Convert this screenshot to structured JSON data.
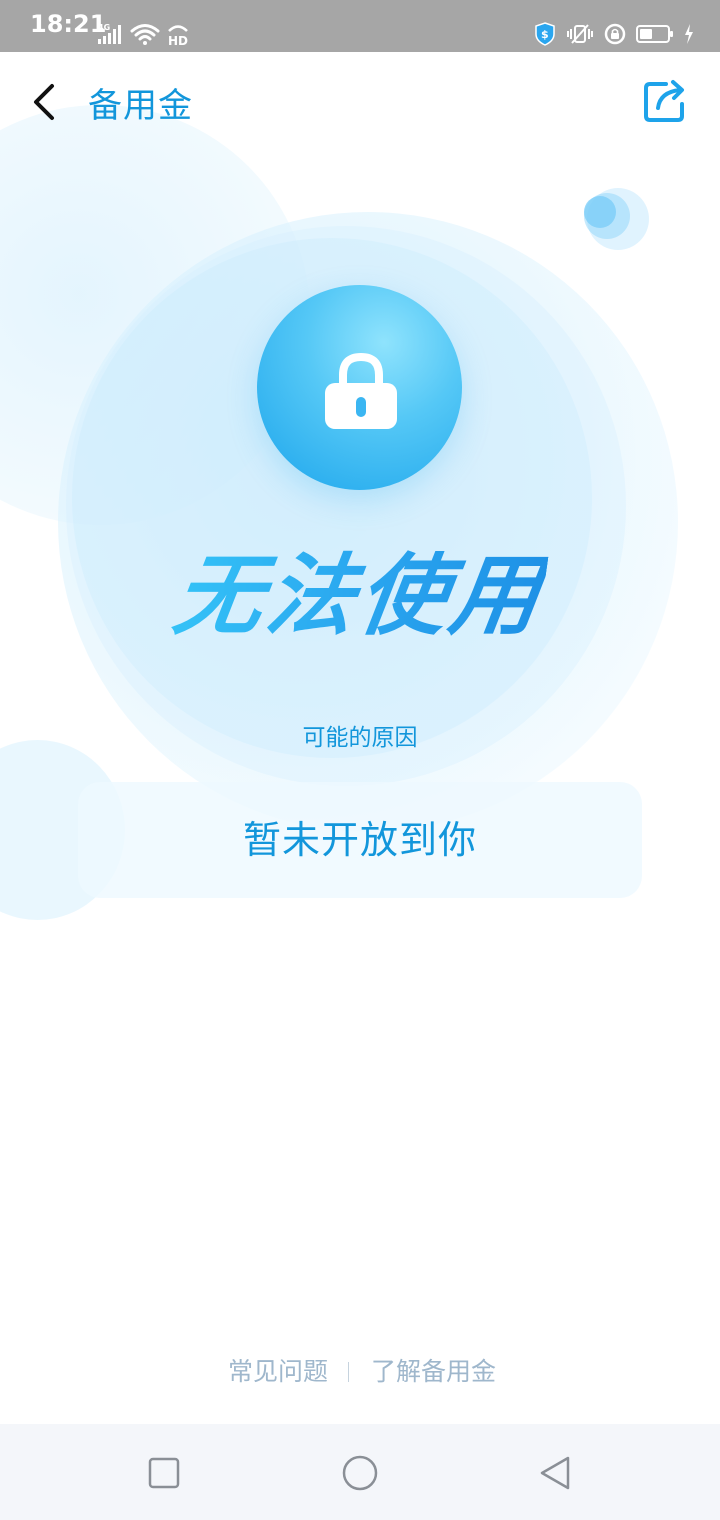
{
  "status_bar": {
    "time": "18:21",
    "network_type": "4G",
    "hd_label": "HD",
    "icons": [
      "signal-icon",
      "wifi-icon",
      "hd-voice-icon",
      "security-shield-icon",
      "vibrate-icon",
      "alarm-lock-icon",
      "battery-icon",
      "charging-icon"
    ]
  },
  "header": {
    "title": "备用金",
    "back_icon": "chevron-left-icon",
    "share_icon": "share-icon"
  },
  "status": {
    "icon": "lock-icon",
    "headline": "无法使用"
  },
  "reason": {
    "label": "可能的原因",
    "text": "暂未开放到你"
  },
  "footer": {
    "links": [
      {
        "label": "常见问题"
      },
      {
        "label": "了解备用金"
      }
    ]
  },
  "nav_bar": {
    "buttons": [
      "recent-apps-icon",
      "home-icon",
      "back-triangle-icon"
    ]
  },
  "colors": {
    "accent": "#1296db",
    "headline": "#26a6ef",
    "footer_link": "#9fb7cc",
    "status_bar_bg": "#a6a6a6",
    "nav_bar_bg": "#f4f6fa"
  }
}
